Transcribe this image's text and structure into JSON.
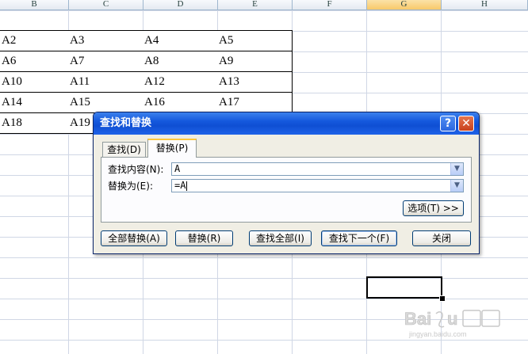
{
  "sheet": {
    "columns": [
      "B",
      "C",
      "D",
      "E",
      "F",
      "G",
      "H"
    ],
    "active_column": "G",
    "rows": [
      [
        "A2",
        "A3",
        "A4",
        "A5"
      ],
      [
        "A6",
        "A7",
        "A8",
        "A9"
      ],
      [
        "A10",
        "A11",
        "A12",
        "A13"
      ],
      [
        "A14",
        "A15",
        "A16",
        "A17"
      ],
      [
        "A18",
        "A19",
        "",
        ""
      ]
    ]
  },
  "dialog": {
    "title": "查找和替换",
    "help_glyph": "?",
    "close_glyph": "✕",
    "tabs": {
      "find": "查找(D)",
      "replace": "替换(P)"
    },
    "active_tab": "replace",
    "find_label": "查找内容(N):",
    "find_value": "A",
    "replace_label": "替换为(E):",
    "replace_value": "=A",
    "options_label": "选项(T) >>",
    "buttons": {
      "replace_all": "全部替换(A)",
      "replace": "替换(R)",
      "find_all": "查找全部(I)",
      "find_next": "查找下一个(F)",
      "close": "关闭"
    }
  },
  "watermark": {
    "brand": "Baidu",
    "suffix": "经验",
    "url": "jingyan.baidu.com"
  }
}
